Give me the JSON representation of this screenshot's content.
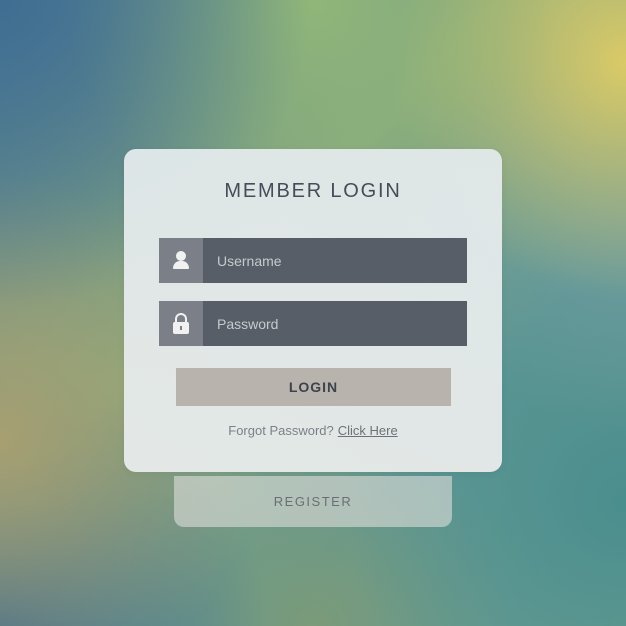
{
  "theme": {
    "card_background": "#E3EAEC",
    "input_background": "#575E68",
    "icon_tile_background": "#7B8088",
    "login_button_background": "#B8B3AD",
    "register_button_background": "#DCDCD8",
    "title_color": "#454D59"
  },
  "login_form": {
    "title": "MEMBER LOGIN",
    "username": {
      "value": "",
      "placeholder": "Username",
      "icon": "user-icon"
    },
    "password": {
      "value": "",
      "placeholder": "Password",
      "icon": "lock-icon"
    },
    "login_button_label": "LOGIN",
    "forgot_text": "Forgot Password?",
    "forgot_link_label": "Click Here",
    "register_button_label": "REGISTER"
  }
}
